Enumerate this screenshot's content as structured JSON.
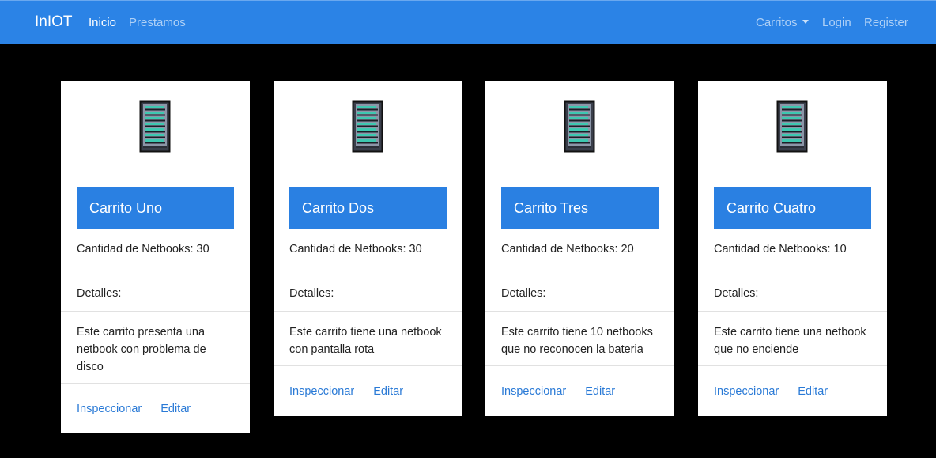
{
  "navbar": {
    "brand": "InIOT",
    "links": [
      "Inicio",
      "Prestamos"
    ],
    "right": {
      "dropdown": "Carritos",
      "login": "Login",
      "register": "Register"
    },
    "color": "#2b83e6"
  },
  "cards": [
    {
      "title": "Carrito Uno",
      "quantity": "Cantidad de Netbooks: 30",
      "details_label": "Detalles:",
      "description": "Este carrito presenta una netbook con problema de disco",
      "inspect": "Inspeccionar",
      "edit": "Editar"
    },
    {
      "title": "Carrito Dos",
      "quantity": "Cantidad de Netbooks: 30",
      "details_label": "Detalles:",
      "description": "Este carrito tiene una netbook con pantalla rota",
      "inspect": "Inspeccionar",
      "edit": "Editar"
    },
    {
      "title": "Carrito Tres",
      "quantity": "Cantidad de Netbooks: 20",
      "details_label": "Detalles:",
      "description": "Este carrito tiene 10 netbooks que no reconocen la bateria",
      "inspect": "Inspeccionar",
      "edit": "Editar"
    },
    {
      "title": "Carrito Cuatro",
      "quantity": "Cantidad de Netbooks: 10",
      "details_label": "Detalles:",
      "description": "Este carrito tiene una netbook que no enciende",
      "inspect": "Inspeccionar",
      "edit": "Editar"
    }
  ],
  "icons": {
    "card_image": "server-rack-icon",
    "dropdown": "caret-down-icon"
  },
  "colors": {
    "accent": "#2a80e2",
    "link": "#2a7ad6",
    "background": "#000000"
  }
}
